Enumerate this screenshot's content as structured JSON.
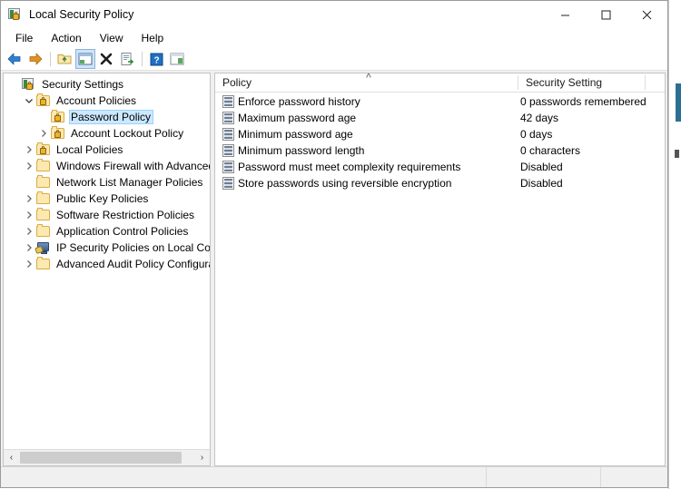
{
  "window": {
    "title": "Local Security Policy",
    "icon": "security-console-icon",
    "controls": {
      "minimize": "–",
      "maximize": "□",
      "close": "✕"
    }
  },
  "menubar": {
    "items": [
      {
        "label": "File"
      },
      {
        "label": "Action"
      },
      {
        "label": "View"
      },
      {
        "label": "Help"
      }
    ]
  },
  "toolbar": {
    "buttons": [
      {
        "name": "back-button",
        "icon": "left-arrow-icon",
        "glyph": "←"
      },
      {
        "name": "forward-button",
        "icon": "right-arrow-icon",
        "glyph": "→"
      },
      {
        "name": "up-one-level-button",
        "icon": "folder-up-icon",
        "glyph": "↑"
      },
      {
        "name": "show-hide-tree-button",
        "icon": "tree-pane-icon",
        "glyph": "▤",
        "pressed": true
      },
      {
        "name": "delete-button",
        "icon": "delete-x-icon",
        "glyph": "✖"
      },
      {
        "name": "export-list-button",
        "icon": "export-icon",
        "glyph": "☰"
      },
      {
        "name": "help-button",
        "icon": "question-mark-icon",
        "glyph": "?"
      },
      {
        "name": "properties-button",
        "icon": "properties-icon",
        "glyph": "▥"
      }
    ]
  },
  "tree": {
    "nodes": [
      {
        "label": "Security Settings",
        "indent": 0,
        "twist": "none",
        "icon": "security-console-icon",
        "selected": false
      },
      {
        "label": "Account Policies",
        "indent": 1,
        "twist": "expanded",
        "icon": "folder-lock-icon",
        "selected": false
      },
      {
        "label": "Password Policy",
        "indent": 2,
        "twist": "none",
        "icon": "folder-lock-icon",
        "selected": true
      },
      {
        "label": "Account Lockout Policy",
        "indent": 2,
        "twist": "collapsed",
        "icon": "folder-lock-icon",
        "selected": false
      },
      {
        "label": "Local Policies",
        "indent": 1,
        "twist": "collapsed",
        "icon": "folder-lock-icon",
        "selected": false
      },
      {
        "label": "Windows Firewall with Advanced Secu",
        "indent": 1,
        "twist": "collapsed",
        "icon": "folder-icon",
        "selected": false
      },
      {
        "label": "Network List Manager Policies",
        "indent": 1,
        "twist": "none",
        "icon": "folder-icon",
        "selected": false
      },
      {
        "label": "Public Key Policies",
        "indent": 1,
        "twist": "collapsed",
        "icon": "folder-icon",
        "selected": false
      },
      {
        "label": "Software Restriction Policies",
        "indent": 1,
        "twist": "collapsed",
        "icon": "folder-icon",
        "selected": false
      },
      {
        "label": "Application Control Policies",
        "indent": 1,
        "twist": "collapsed",
        "icon": "folder-icon",
        "selected": false
      },
      {
        "label": "IP Security Policies on Local Compute",
        "indent": 1,
        "twist": "collapsed",
        "icon": "ip-security-monitor-icon",
        "selected": false
      },
      {
        "label": "Advanced Audit Policy Configuration",
        "indent": 1,
        "twist": "collapsed",
        "icon": "folder-icon",
        "selected": false
      }
    ],
    "scrollbar": {
      "left_arrow": "‹",
      "right_arrow": "›"
    }
  },
  "list": {
    "columns": [
      {
        "label": "Policy",
        "sorted": "ascending",
        "sort_glyph": "˄"
      },
      {
        "label": "Security Setting"
      }
    ],
    "rows": [
      {
        "policy": "Enforce password history",
        "setting": "0 passwords remembered"
      },
      {
        "policy": "Maximum password age",
        "setting": "42 days"
      },
      {
        "policy": "Minimum password age",
        "setting": "0 days"
      },
      {
        "policy": "Minimum password length",
        "setting": "0 characters"
      },
      {
        "policy": "Password must meet complexity requirements",
        "setting": "Disabled"
      },
      {
        "policy": "Store passwords using reversible encryption",
        "setting": "Disabled"
      }
    ]
  },
  "statusbar": {
    "segments": [
      "",
      "",
      ""
    ]
  },
  "colors": {
    "selection": "#cce8ff",
    "selection_border": "#99d1ff",
    "window_bg": "#ffffff",
    "chrome_bg": "#f0f0f0",
    "border": "#c4c4c4",
    "back_arrow": "#2f7fd1",
    "forward_arrow": "#e0921f",
    "folder": "#fde8b0",
    "lock": "#f0b323"
  }
}
